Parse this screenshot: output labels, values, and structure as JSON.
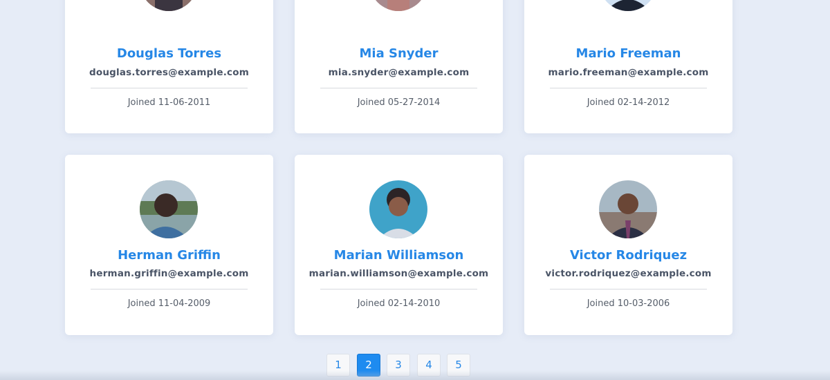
{
  "users": [
    {
      "name": "Douglas Torres",
      "email": "douglas.torres@example.com",
      "joined": "Joined 11-06-2011",
      "avatar": "avatar-photo"
    },
    {
      "name": "Mia Snyder",
      "email": "mia.snyder@example.com",
      "joined": "Joined 05-27-2014",
      "avatar": "avatar-photo"
    },
    {
      "name": "Mario Freeman",
      "email": "mario.freeman@example.com",
      "joined": "Joined 02-14-2012",
      "avatar": "avatar-photo"
    },
    {
      "name": "Herman Griffin",
      "email": "herman.griffin@example.com",
      "joined": "Joined 11-04-2009",
      "avatar": "avatar-photo"
    },
    {
      "name": "Marian Williamson",
      "email": "marian.williamson@example.com",
      "joined": "Joined 02-14-2010",
      "avatar": "avatar-photo"
    },
    {
      "name": "Victor Rodriquez",
      "email": "victor.rodriquez@example.com",
      "joined": "Joined 10-03-2006",
      "avatar": "avatar-photo"
    }
  ],
  "pagination": {
    "pages": [
      "1",
      "2",
      "3",
      "4",
      "5"
    ],
    "current": "2"
  },
  "colors": {
    "accent": "#2687e6",
    "background": "#e6ecf7",
    "card": "#ffffff",
    "active_page": "#1e8bf0"
  }
}
